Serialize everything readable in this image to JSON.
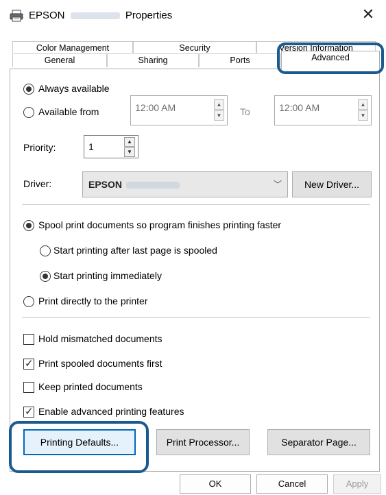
{
  "window": {
    "title_prefix": "EPSON",
    "title_suffix": "Properties",
    "close_glyph": "✕"
  },
  "tabs": {
    "row1": [
      "Color Management",
      "Security",
      "Version Information"
    ],
    "row2": [
      "General",
      "Sharing",
      "Ports",
      "Advanced"
    ],
    "active": "Advanced"
  },
  "availability": {
    "always_label": "Always available",
    "from_label": "Available from",
    "from_time": "12:00 AM",
    "to_label": "To",
    "to_time": "12:00 AM",
    "selected": "always"
  },
  "priority": {
    "label": "Priority:",
    "value": "1"
  },
  "driver": {
    "label": "Driver:",
    "value": "EPSON",
    "new_driver_label": "New Driver..."
  },
  "spooling": {
    "spool_label": "Spool print documents so program finishes printing faster",
    "after_last_page_label": "Start printing after last page is spooled",
    "immediately_label": "Start printing immediately",
    "direct_label": "Print directly to the printer"
  },
  "options": [
    {
      "label": "Hold mismatched documents",
      "checked": false
    },
    {
      "label": "Print spooled documents first",
      "checked": true
    },
    {
      "label": "Keep printed documents",
      "checked": false
    },
    {
      "label": "Enable advanced printing features",
      "checked": true
    }
  ],
  "buttons": {
    "printing_defaults": "Printing Defaults...",
    "print_processor": "Print Processor...",
    "separator_page": "Separator Page...",
    "ok": "OK",
    "cancel": "Cancel",
    "apply": "Apply"
  },
  "colors": {
    "highlight": "#1b5a8f",
    "default_button_border": "#0067c0"
  }
}
